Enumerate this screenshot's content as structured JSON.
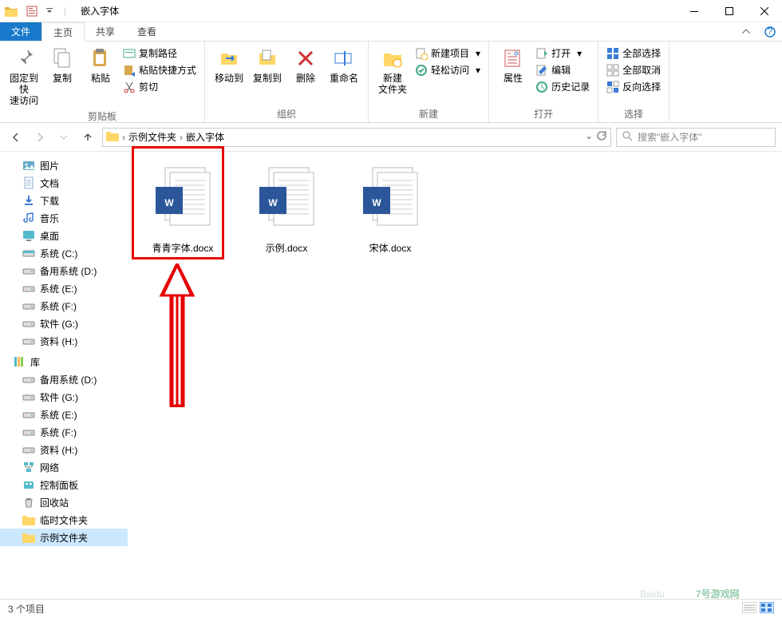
{
  "window": {
    "title": "嵌入字体"
  },
  "tabs": {
    "file": "文件",
    "home": "主页",
    "share": "共享",
    "view": "查看"
  },
  "ribbon": {
    "pin": "固定到快\n速访问",
    "copy": "复制",
    "paste": "粘贴",
    "copypath": "复制路径",
    "pasteshortcut": "粘贴快捷方式",
    "cut": "剪切",
    "clipboard_group": "剪贴板",
    "moveto": "移动到",
    "copyto": "复制到",
    "delete": "删除",
    "rename": "重命名",
    "organize_group": "组织",
    "newfolder": "新建\n文件夹",
    "newitem": "新建项目",
    "easyaccess": "轻松访问",
    "new_group": "新建",
    "properties": "属性",
    "open": "打开",
    "edit": "编辑",
    "history": "历史记录",
    "open_group": "打开",
    "selectall": "全部选择",
    "selectnone": "全部取消",
    "invertsel": "反向选择",
    "select_group": "选择"
  },
  "breadcrumb": {
    "items": [
      "示例文件夹",
      "嵌入字体"
    ]
  },
  "search": {
    "placeholder": "搜索\"嵌入字体\""
  },
  "tree": [
    {
      "label": "图片",
      "icon": "pictures"
    },
    {
      "label": "文档",
      "icon": "documents"
    },
    {
      "label": "下载",
      "icon": "downloads"
    },
    {
      "label": "音乐",
      "icon": "music"
    },
    {
      "label": "桌面",
      "icon": "desktop"
    },
    {
      "label": "系统 (C:)",
      "icon": "drive-c"
    },
    {
      "label": "备用系统 (D:)",
      "icon": "drive"
    },
    {
      "label": "系统 (E:)",
      "icon": "drive"
    },
    {
      "label": "系统 (F:)",
      "icon": "drive"
    },
    {
      "label": "软件 (G:)",
      "icon": "drive"
    },
    {
      "label": "资料 (H:)",
      "icon": "drive"
    },
    {
      "label": "库",
      "icon": "lib",
      "lib": true
    },
    {
      "label": "备用系统 (D:)",
      "icon": "drive"
    },
    {
      "label": "软件 (G:)",
      "icon": "drive"
    },
    {
      "label": "系统 (E:)",
      "icon": "drive"
    },
    {
      "label": "系统 (F:)",
      "icon": "drive"
    },
    {
      "label": "资料 (H:)",
      "icon": "drive"
    },
    {
      "label": "网络",
      "icon": "network"
    },
    {
      "label": "控制面板",
      "icon": "cpanel"
    },
    {
      "label": "回收站",
      "icon": "recycle"
    },
    {
      "label": "临时文件夹",
      "icon": "folder"
    },
    {
      "label": "示例文件夹",
      "icon": "folder",
      "selected": true
    }
  ],
  "files": [
    {
      "name": "青青字体.docx",
      "highlighted": true
    },
    {
      "name": "示例.docx"
    },
    {
      "name": "宋体.docx"
    }
  ],
  "status": {
    "count": "3 个项目"
  },
  "colors": {
    "accent": "#1979ca",
    "highlight": "#e60000",
    "word_blue": "#2b579a"
  }
}
